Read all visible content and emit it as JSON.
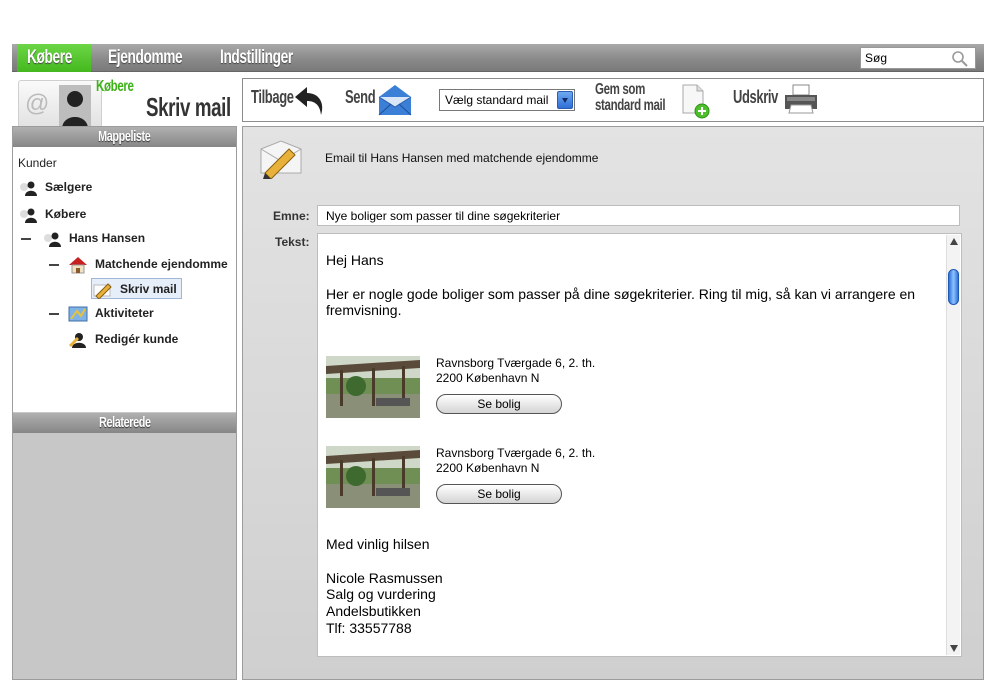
{
  "nav": {
    "tabs": [
      {
        "label": "Købere",
        "active": true
      },
      {
        "label": "Ejendomme",
        "active": false
      },
      {
        "label": "Indstillinger",
        "active": false
      }
    ],
    "search_value": "Søg"
  },
  "header": {
    "crumb_small": "Købere",
    "crumb_large": "Skriv mail"
  },
  "toolbar": {
    "back_label": "Tilbage",
    "send_label": "Send",
    "select_value": "Vælg standard mail",
    "save_label_line1": "Gem som",
    "save_label_line2": "standard mail",
    "print_label": "Udskriv"
  },
  "sidebar": {
    "panel_title": "Mappeliste",
    "related_title": "Relaterede",
    "root": "Kunder",
    "items": {
      "saelgere": "Sælgere",
      "kobere": "Købere",
      "hans": "Hans Hansen",
      "match": "Matchende ejendomme",
      "skriv": "Skriv mail",
      "akt": "Aktiviteter",
      "redig": "Redigér kunde"
    }
  },
  "mail": {
    "heading": "Email til Hans Hansen med matchende ejendomme",
    "subject_label": "Emne:",
    "subject_value": "Nye boliger som passer til dine søgekriterier",
    "body_label": "Tekst:",
    "greeting": "Hej Hans",
    "intro": "Her er nogle gode boliger som passer på dine søgekriterier. Ring til mig, så kan vi arrangere en fremvisning.",
    "listings": [
      {
        "address1": "Ravnsborg Tværgade 6, 2. th.",
        "address2": "2200 København N",
        "button": "Se bolig"
      },
      {
        "address1": "Ravnsborg Tværgade 6, 2. th.",
        "address2": "2200 København N",
        "button": "Se bolig"
      }
    ],
    "signoff": "Med vinlig hilsen",
    "signature": {
      "name": "Nicole Rasmussen",
      "title": "Salg og vurdering",
      "company": "Andelsbutikken",
      "phone": "Tlf: 33557788"
    }
  },
  "colors": {
    "accent_green": "#44b81e",
    "nav_gray": "#8a8a8a",
    "scroll_blue": "#2f74d8"
  }
}
